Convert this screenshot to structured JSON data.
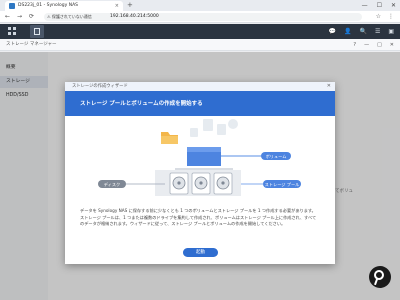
{
  "browser": {
    "tab_title": "DS223j_01 - Synology NAS",
    "tab_close": "×",
    "new_tab": "+",
    "window_controls": [
      "—",
      "☐",
      "✕"
    ],
    "nav": {
      "back": "←",
      "forward": "→",
      "reload": "⟳"
    },
    "security_warning": "⚠ 保護されていない通信",
    "url": "192.168.40.214:5000",
    "addr_icons": [
      "☆",
      "⋮"
    ]
  },
  "dsm": {
    "top_icons": [
      "💬",
      "👤",
      "🔍",
      "☰",
      "▣"
    ]
  },
  "storage_manager": {
    "title": "ストレージ マネージャー",
    "window_buttons": [
      "?",
      "—",
      "□",
      "✕"
    ],
    "sidebar": [
      {
        "label": "概要"
      },
      {
        "label": "ストレージ"
      },
      {
        "label": "HDD/SSD"
      }
    ],
    "main_peek": "てボリュ"
  },
  "wizard": {
    "title": "ストレージの作成ウィザード",
    "close": "✕",
    "heading": "ストレージ プールとボリュームの作成を開始する",
    "labels": {
      "volume": "ボリューム",
      "disk": "ディスク",
      "storage_pool": "ストレージ プール"
    },
    "description": "データを Synology NAS に保存する前に少なくとも 1 つのボリュームとストレージ プールを 1 つ作成する必要があります。ストレージ プールは、1 つまたは複数のドライブを集約して作成され、ボリュームはストレージ プール上に作成され、すべてのデータが格納されます。ウィザードに従って、ストレージ プールとボリュームの作成を開始してください。",
    "start_button": "起動"
  },
  "colors": {
    "accent": "#2f6dd0",
    "dsm_bar": "#2b3440"
  },
  "icons": {
    "lens_badge": "magnifier-badge-icon"
  }
}
